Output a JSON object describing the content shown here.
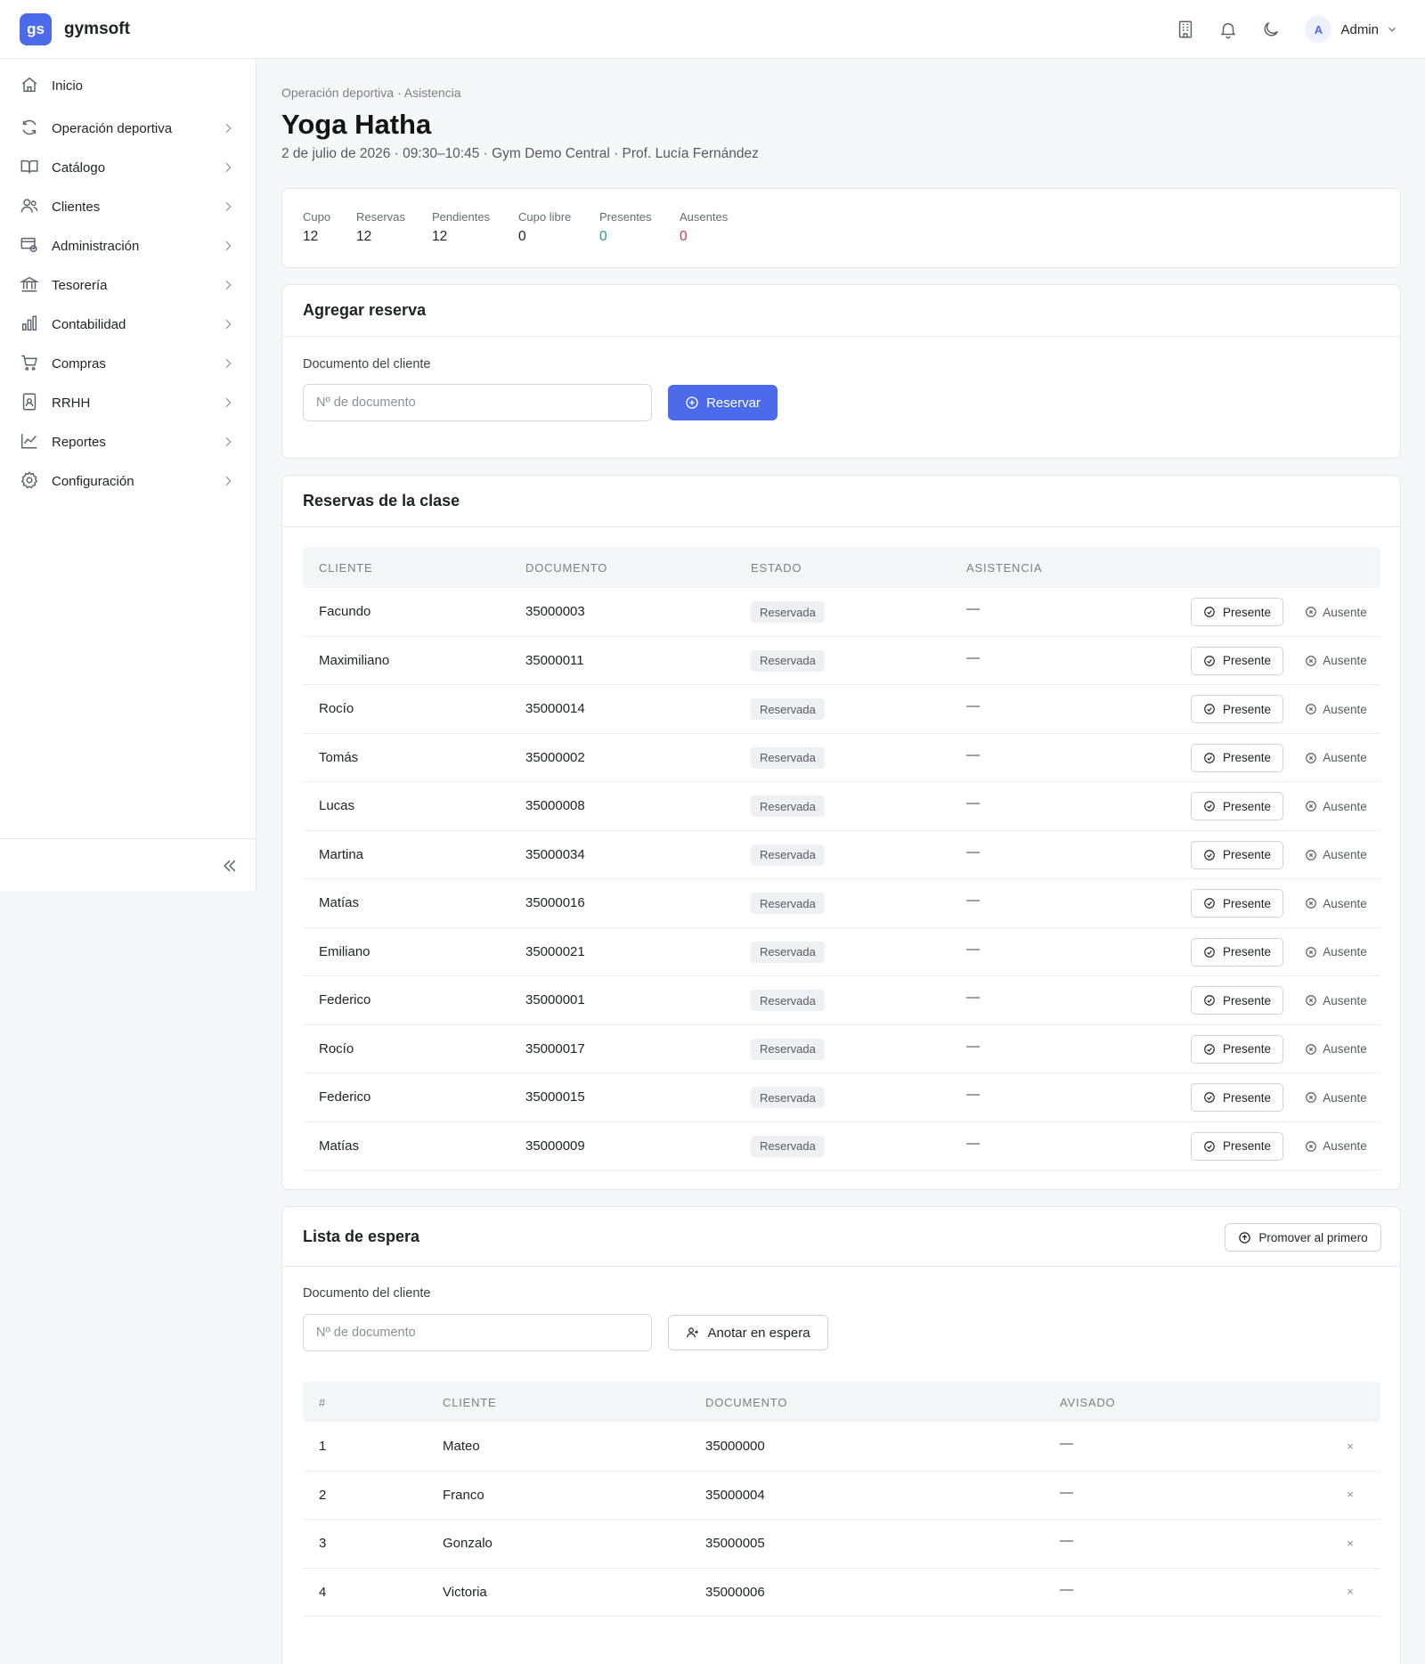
{
  "app": {
    "logo_text": "gs",
    "name": "gymsoft",
    "user_initial": "A",
    "user_name": "Admin",
    "accent_color": "#4c6bea"
  },
  "sidebar": {
    "items": [
      {
        "label": "Inicio",
        "icon": "home-icon",
        "has_children": false
      },
      {
        "label": "Operación deportiva",
        "icon": "refresh-icon",
        "has_children": true
      },
      {
        "label": "Catálogo",
        "icon": "book-icon",
        "has_children": true
      },
      {
        "label": "Clientes",
        "icon": "users-icon",
        "has_children": true
      },
      {
        "label": "Administración",
        "icon": "admin-icon",
        "has_children": true
      },
      {
        "label": "Tesorería",
        "icon": "bank-icon",
        "has_children": true
      },
      {
        "label": "Contabilidad",
        "icon": "bar-chart-icon",
        "has_children": true
      },
      {
        "label": "Compras",
        "icon": "cart-icon",
        "has_children": true
      },
      {
        "label": "RRHH",
        "icon": "id-badge-icon",
        "has_children": true
      },
      {
        "label": "Reportes",
        "icon": "line-chart-icon",
        "has_children": true
      },
      {
        "label": "Configuración",
        "icon": "gear-icon",
        "has_children": true
      }
    ]
  },
  "page": {
    "breadcrumb": "Operación deportiva · Asistencia",
    "title": "Yoga Hatha",
    "subtitle": "2 de julio de 2026 · 09:30–10:45 · Gym Demo Central · Prof. Lucía Fernández"
  },
  "stats": [
    {
      "label": "Cupo",
      "value": "12",
      "color": "#1f2328"
    },
    {
      "label": "Reservas",
      "value": "12",
      "color": "#1f2328"
    },
    {
      "label": "Pendientes",
      "value": "12",
      "color": "#1f2328"
    },
    {
      "label": "Cupo libre",
      "value": "0",
      "color": "#1f2328"
    },
    {
      "label": "Presentes",
      "value": "0",
      "color": "#1f9e6e"
    },
    {
      "label": "Ausentes",
      "value": "0",
      "color": "#d2394b"
    }
  ],
  "add_booking": {
    "title": "Agregar reserva",
    "field_label": "Documento del cliente",
    "placeholder": "Nº de documento",
    "value": "",
    "button": "Reservar"
  },
  "bookings": {
    "title": "Reservas de la clase",
    "columns": [
      "CLIENTE",
      "DOCUMENTO",
      "ESTADO",
      "ASISTENCIA"
    ],
    "present_label": "Presente",
    "absent_label": "Ausente",
    "rows": [
      {
        "client": "Facundo",
        "doc": "35000003",
        "status": "Reservada",
        "attendance": "—"
      },
      {
        "client": "Maximiliano",
        "doc": "35000011",
        "status": "Reservada",
        "attendance": "—"
      },
      {
        "client": "Rocío",
        "doc": "35000014",
        "status": "Reservada",
        "attendance": "—"
      },
      {
        "client": "Tomás",
        "doc": "35000002",
        "status": "Reservada",
        "attendance": "—"
      },
      {
        "client": "Lucas",
        "doc": "35000008",
        "status": "Reservada",
        "attendance": "—"
      },
      {
        "client": "Martina",
        "doc": "35000034",
        "status": "Reservada",
        "attendance": "—"
      },
      {
        "client": "Matías",
        "doc": "35000016",
        "status": "Reservada",
        "attendance": "—"
      },
      {
        "client": "Emiliano",
        "doc": "35000021",
        "status": "Reservada",
        "attendance": "—"
      },
      {
        "client": "Federico",
        "doc": "35000001",
        "status": "Reservada",
        "attendance": "—"
      },
      {
        "client": "Rocío",
        "doc": "35000017",
        "status": "Reservada",
        "attendance": "—"
      },
      {
        "client": "Federico",
        "doc": "35000015",
        "status": "Reservada",
        "attendance": "—"
      },
      {
        "client": "Matías",
        "doc": "35000009",
        "status": "Reservada",
        "attendance": "—"
      }
    ]
  },
  "waitlist": {
    "title": "Lista de espera",
    "promote_button": "Promover al primero",
    "field_label": "Documento del cliente",
    "placeholder": "Nº de documento",
    "value": "",
    "add_button": "Anotar en espera",
    "columns": [
      "#",
      "CLIENTE",
      "DOCUMENTO",
      "AVISADO"
    ],
    "remove_symbol": "×",
    "rows": [
      {
        "n": "1",
        "client": "Mateo",
        "doc": "35000000",
        "notified": "—"
      },
      {
        "n": "2",
        "client": "Franco",
        "doc": "35000004",
        "notified": "—"
      },
      {
        "n": "3",
        "client": "Gonzalo",
        "doc": "35000005",
        "notified": "—"
      },
      {
        "n": "4",
        "client": "Victoria",
        "doc": "35000006",
        "notified": "—"
      }
    ]
  }
}
